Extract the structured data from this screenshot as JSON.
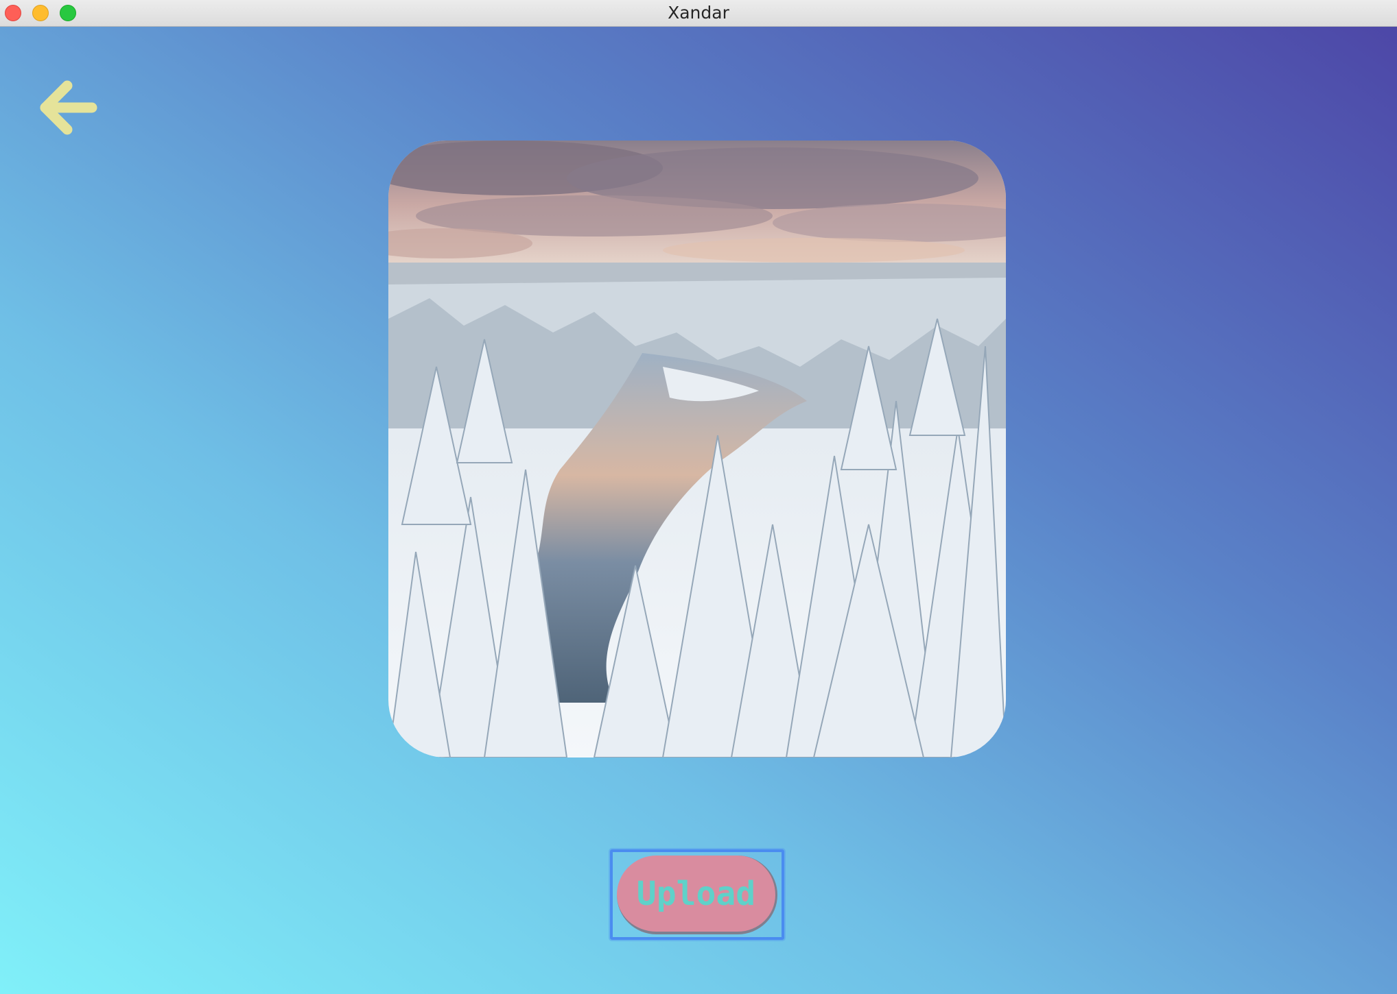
{
  "window": {
    "title": "Xandar"
  },
  "back_button": {
    "icon": "arrow-left-icon",
    "color": "#e5e39a"
  },
  "photo": {
    "subject": "snowy-forest-river-image"
  },
  "upload_button": {
    "label": "Upload",
    "background": "#d98c9f",
    "text_color": "#5fd1c9",
    "focus_ring": "#4a8cf0"
  },
  "colors": {
    "gradient_light": "#80f0f9",
    "gradient_dark": "#4d47a7"
  }
}
